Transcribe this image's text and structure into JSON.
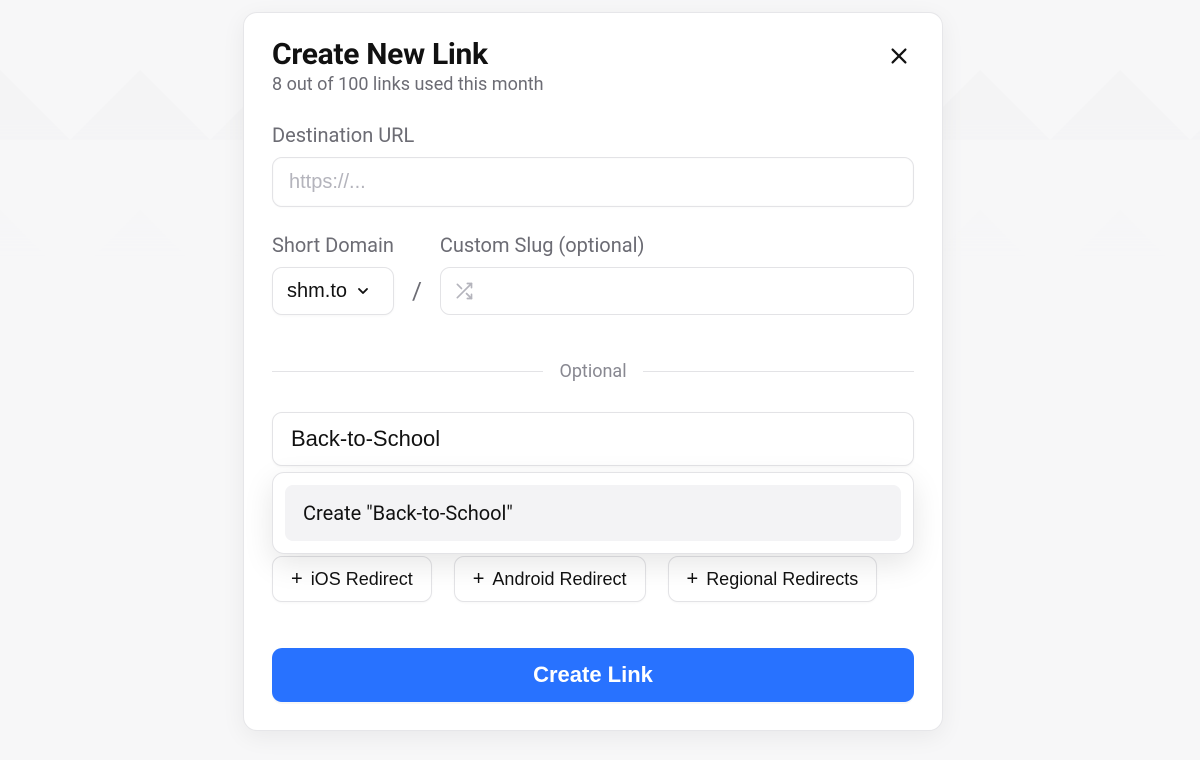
{
  "modal": {
    "title": "Create New Link",
    "subtitle": "8 out of 100 links used this month",
    "destination": {
      "label": "Destination URL",
      "value": "",
      "placeholder": "https://..."
    },
    "short_domain": {
      "label": "Short Domain",
      "selected": "shm.to"
    },
    "slug": {
      "label": "Custom Slug (optional)",
      "value": "",
      "placeholder": ""
    },
    "divider_label": "Optional",
    "search": {
      "value": "Back-to-School",
      "suggestion": "Create \"Back-to-School\""
    },
    "chips": {
      "ios": "iOS Redirect",
      "android": "Android Redirect",
      "regional": "Regional Redirects"
    },
    "submit_label": "Create Link"
  },
  "icons": {
    "close": "close-icon",
    "chevron_down": "chevron-down-icon",
    "shuffle": "shuffle-icon",
    "plus": "plus-icon"
  },
  "colors": {
    "primary": "#2872ff",
    "text": "#111111",
    "muted": "#6c6c74",
    "border": "#e3e3e6",
    "dropdown_item_bg": "#f3f3f5"
  }
}
